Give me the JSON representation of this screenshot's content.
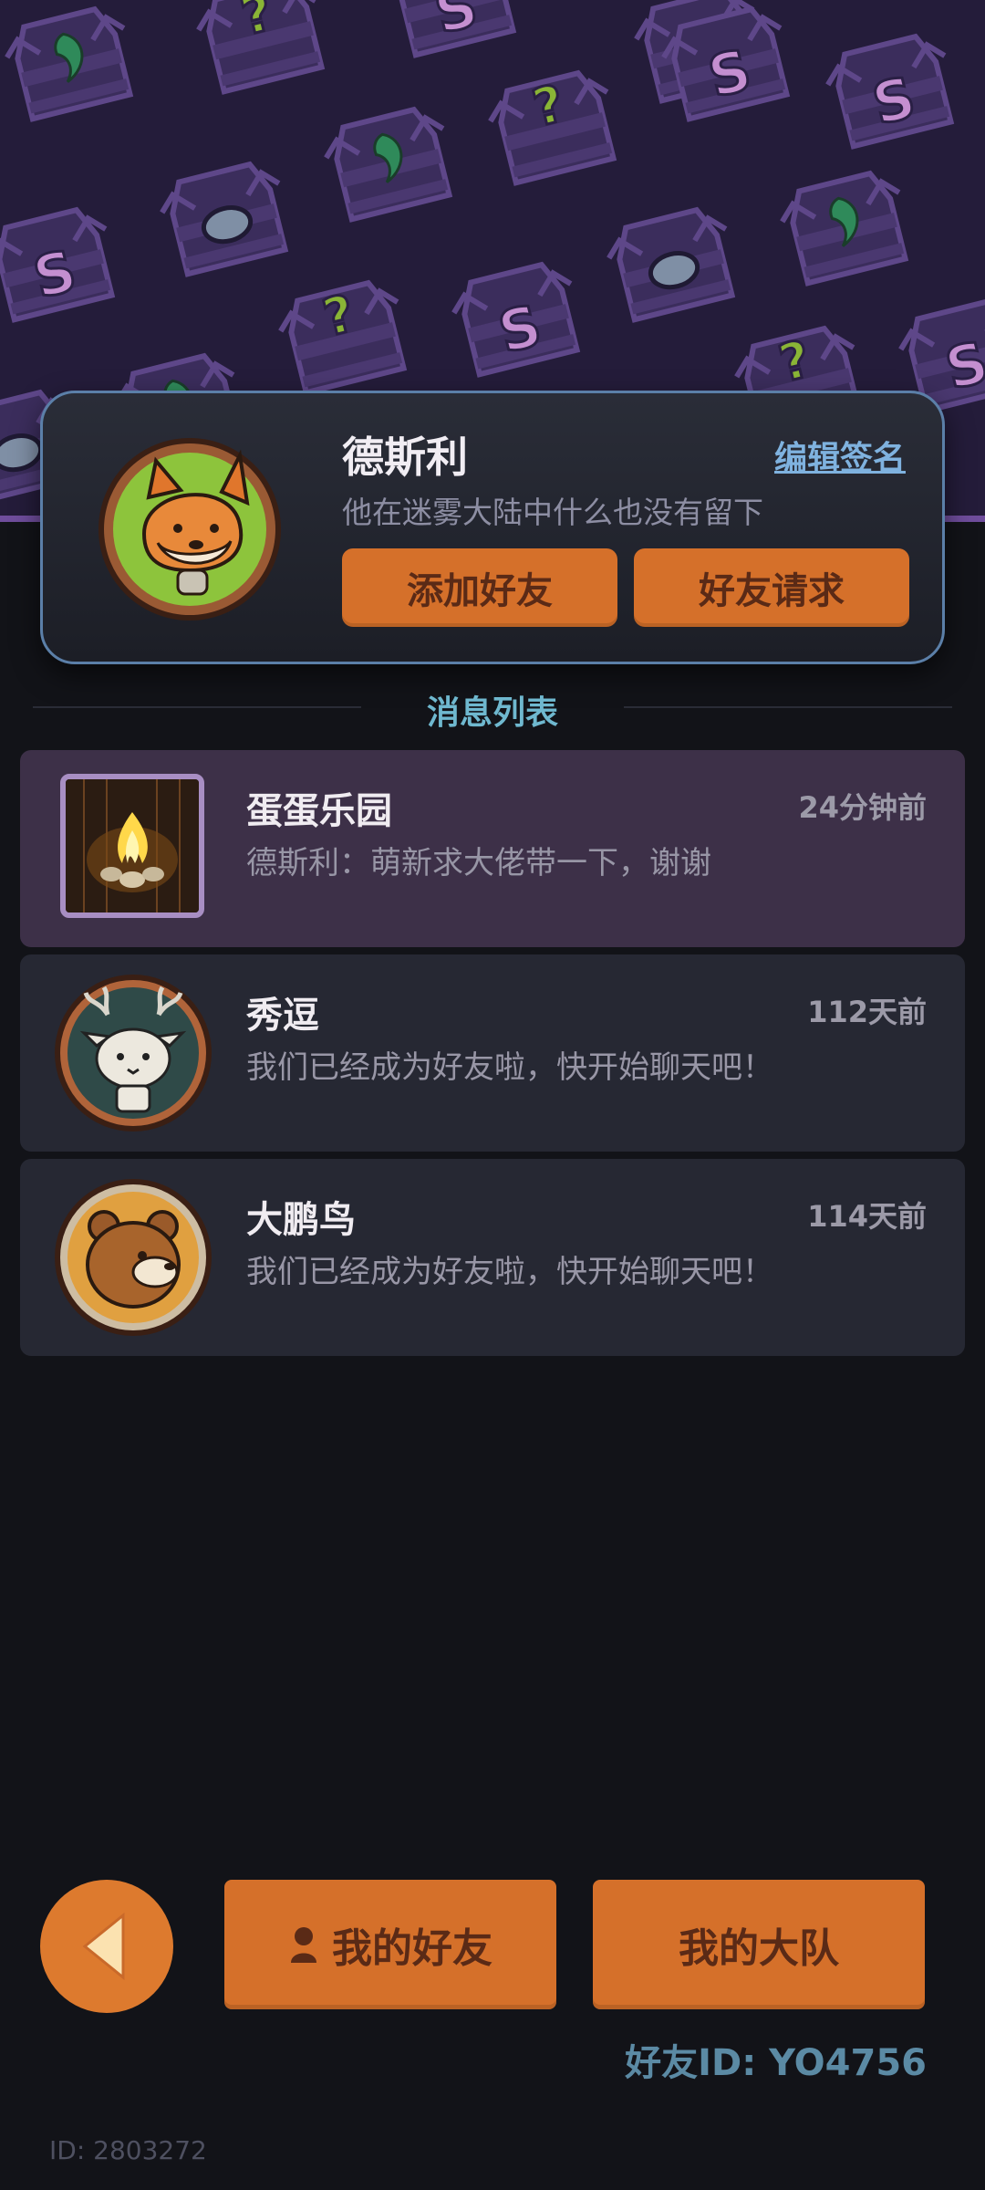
{
  "profile": {
    "name": "德斯利",
    "signature": "他在迷雾大陆中什么也没有留下",
    "edit_signature_label": "编辑签名",
    "add_friend_label": "添加好友",
    "friend_request_label": "好友请求"
  },
  "messages": {
    "section_title": "消息列表",
    "items": [
      {
        "title": "蛋蛋乐园",
        "time": "24分钟前",
        "preview": "德斯利：萌新求大佬带一下，谢谢",
        "avatar": "campfire-icon"
      },
      {
        "title": "秀逗",
        "time": "112天前",
        "preview": "我们已经成为好友啦，快开始聊天吧！",
        "avatar": "antlered-cat-avatar"
      },
      {
        "title": "大鹏鸟",
        "time": "114天前",
        "preview": "我们已经成为好友啦，快开始聊天吧！",
        "avatar": "bear-avatar"
      }
    ]
  },
  "nav": {
    "my_friends_label": "我的好友",
    "my_team_label": "我的大队",
    "back_icon": "back-arrow-icon"
  },
  "friend_id": "好友ID: YO4756",
  "account_id": "ID: 2803272",
  "colors": {
    "accent_orange": "#d5702a",
    "link_blue": "#7fb2df",
    "section_teal": "#6fb8cf",
    "active_row": "#3d3048"
  }
}
